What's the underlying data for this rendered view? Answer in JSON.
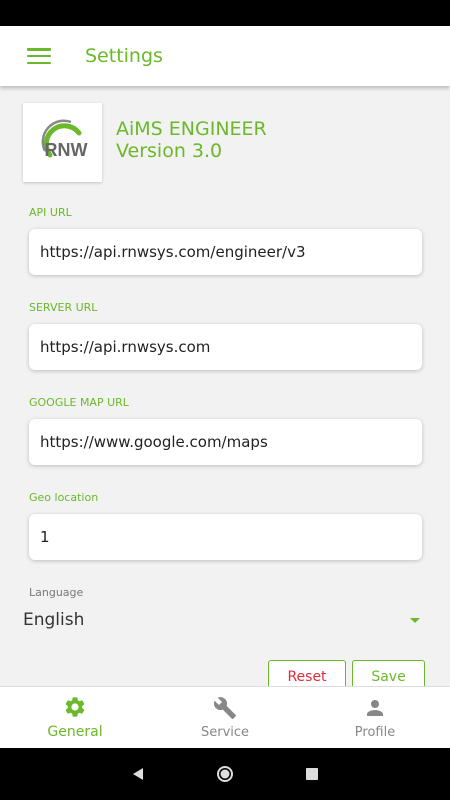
{
  "app_bar": {
    "title": "Settings"
  },
  "header": {
    "logo_text": "RNW",
    "app_name": "AiMS ENGINEER",
    "version": "Version 3.0"
  },
  "fields": [
    {
      "label": "API URL",
      "value": "https://api.rnwsys.com/engineer/v3"
    },
    {
      "label": "SERVER URL",
      "value": "https://api.rnwsys.com"
    },
    {
      "label": "GOOGLE MAP URL",
      "value": "https://www.google.com/maps"
    },
    {
      "label": "Geo location",
      "value": "1"
    }
  ],
  "language": {
    "label": "Language",
    "value": "English"
  },
  "buttons": {
    "reset": "Reset",
    "save": "Save"
  },
  "bottom_nav": [
    {
      "label": "General",
      "icon": "gear-icon",
      "active": true
    },
    {
      "label": "Service",
      "icon": "wrench-icon",
      "active": false
    },
    {
      "label": "Profile",
      "icon": "person-icon",
      "active": false
    }
  ],
  "colors": {
    "accent": "#6bb82a",
    "danger": "#e02d3c"
  }
}
